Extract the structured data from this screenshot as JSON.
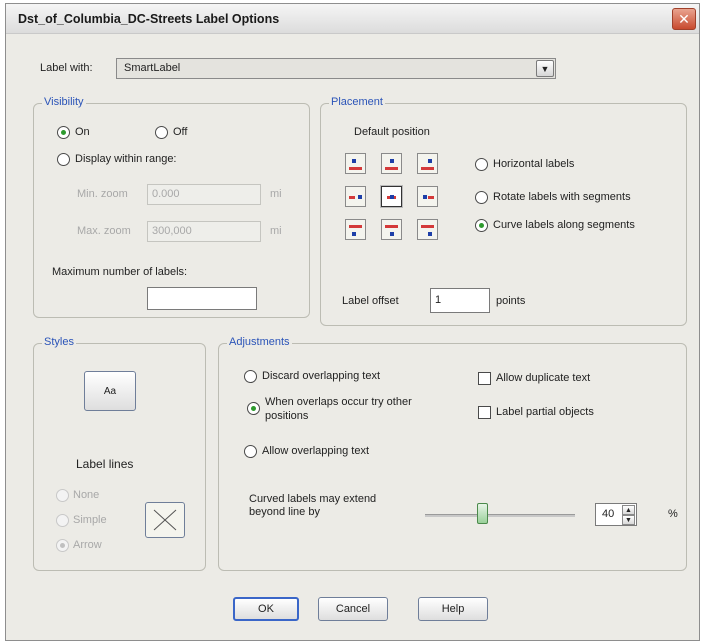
{
  "window": {
    "title": "Dst_of_Columbia_DC-Streets Label Options",
    "close_glyph": "✕"
  },
  "label_with": {
    "label": "Label with:",
    "value": "SmartLabel"
  },
  "visibility": {
    "title": "Visibility",
    "on": "On",
    "off": "Off",
    "display_within_range": "Display within range:",
    "min_zoom_label": "Min. zoom",
    "min_zoom_value": "0.000",
    "max_zoom_label": "Max. zoom",
    "max_zoom_value": "300,000",
    "unit": "mi",
    "max_labels_label": "Maximum number of labels:",
    "max_labels_value": ""
  },
  "placement": {
    "title": "Placement",
    "default_position": "Default position",
    "horizontal": "Horizontal labels",
    "rotate": "Rotate labels with segments",
    "curve": "Curve labels along segments",
    "selected_mode": "curve",
    "label_offset_label": "Label offset",
    "label_offset_value": "1",
    "points": "points"
  },
  "styles": {
    "title": "Styles",
    "style_button": "Aa",
    "label_lines": "Label lines",
    "none": "None",
    "simple": "Simple",
    "arrow": "Arrow"
  },
  "adjustments": {
    "title": "Adjustments",
    "discard": "Discard overlapping text",
    "when_overlaps_line1": "When overlaps occur try other",
    "when_overlaps_line2": "positions",
    "allow_overlapping": "Allow overlapping text",
    "allow_duplicate": "Allow duplicate text",
    "label_partial": "Label partial objects",
    "curved_extend_line1": "Curved labels may extend",
    "curved_extend_line2": "beyond line by",
    "curved_extend_percent": 40,
    "curved_extend_value": "40",
    "percent_sign": "%"
  },
  "buttons": {
    "ok": "OK",
    "cancel": "Cancel",
    "help": "Help"
  },
  "colors": {
    "group_title": "#2b54b8",
    "radio_checked": "#2e9a2e",
    "default_button_border": "#3a66c8"
  }
}
